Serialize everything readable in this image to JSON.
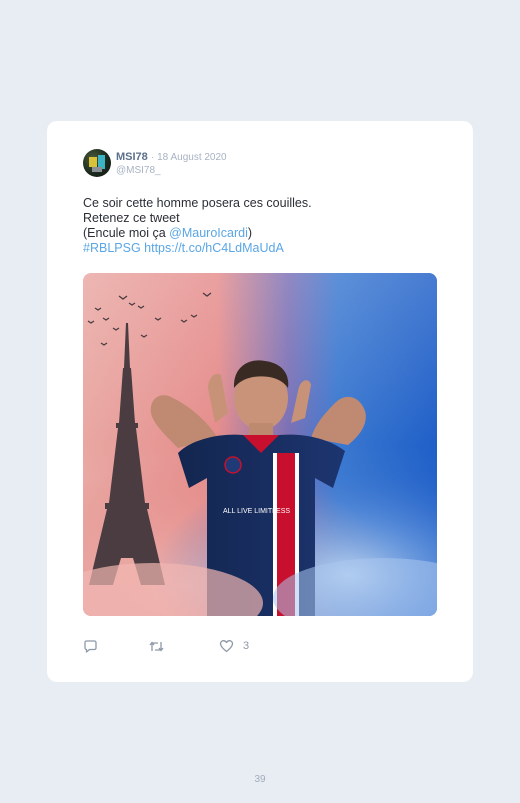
{
  "tweet": {
    "username": "MSI78",
    "date": "· 18 August 2020",
    "handle": "@MSI78_",
    "text_line1": "Ce soir cette homme posera ces couilles.",
    "text_line2": "Retenez ce tweet",
    "text_line3_prefix": "(Encule moi ça ",
    "mention": "@MauroIcardi",
    "text_line3_suffix": ")",
    "hashtag": "#RBLPSG",
    "url": "https://t.co/hC4LdMaUdA",
    "like_count": "3",
    "jersey_text": "ALL LIVE LIMITLESS"
  },
  "icons": {
    "reply": "comment-icon",
    "retweet": "retweet-icon",
    "like": "heart-icon"
  },
  "colors": {
    "background": "#e8ecf3",
    "card": "#ffffff",
    "link": "#5aa6e6",
    "username": "#5b6f8c",
    "meta": "#a8b3c2",
    "icon": "#8f99a8"
  },
  "page": {
    "number": "39"
  }
}
